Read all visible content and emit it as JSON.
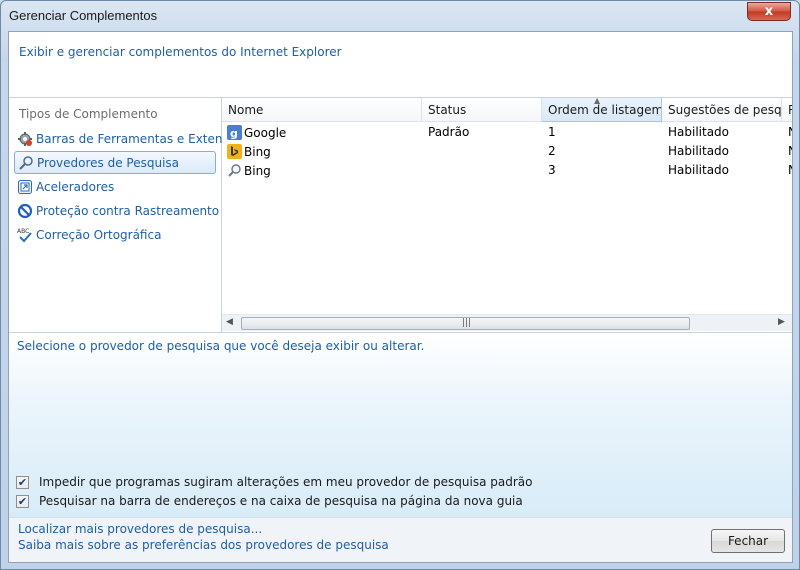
{
  "window": {
    "title": "Gerenciar Complementos",
    "close_glyph": "x"
  },
  "header": {
    "description": "Exibir e gerenciar complementos do Internet Explorer"
  },
  "sidebar": {
    "title": "Tipos de Complemento",
    "items": [
      {
        "label": "Barras de Ferramentas e Extensões",
        "icon": "gear-icon",
        "selected": false
      },
      {
        "label": "Provedores de Pesquisa",
        "icon": "search-icon",
        "selected": true
      },
      {
        "label": "Aceleradores",
        "icon": "accelerator-icon",
        "selected": false
      },
      {
        "label": "Proteção contra Rastreamento",
        "icon": "no-tracking-icon",
        "selected": false
      },
      {
        "label": "Correção Ortográfica",
        "icon": "spellcheck-icon",
        "selected": false
      }
    ]
  },
  "table": {
    "columns": [
      "Nome",
      "Status",
      "Ordem de listagem",
      "Sugestões de pesqu...",
      "R"
    ],
    "sorted_column": "Ordem de listagem",
    "rows": [
      {
        "name": "Google",
        "status": "Padrão",
        "order": "1",
        "suggestions": "Habilitado",
        "extra": "N",
        "icon": "google-icon"
      },
      {
        "name": "Bing",
        "status": "",
        "order": "2",
        "suggestions": "Habilitado",
        "extra": "N",
        "icon": "bing-icon"
      },
      {
        "name": "Bing",
        "status": "",
        "order": "3",
        "suggestions": "Habilitado",
        "extra": "N",
        "icon": "search-icon"
      }
    ]
  },
  "details": {
    "prompt": "Selecione o provedor de pesquisa que você deseja exibir ou alterar.",
    "checkboxes": [
      {
        "label": "Impedir que programas sugiram alterações em meu provedor de pesquisa padrão",
        "checked": true
      },
      {
        "label": "Pesquisar na barra de endereços e na caixa de pesquisa na página da nova guia",
        "checked": true
      }
    ]
  },
  "footer": {
    "link_find": "Localizar mais provedores de pesquisa...",
    "link_learn": "Saiba mais sobre as preferências dos provedores de pesquisa",
    "close_label": "Fechar"
  },
  "colors": {
    "link_blue": "#1e5fa8",
    "selection_border": "#84acdd",
    "close_red": "#d2533d"
  }
}
